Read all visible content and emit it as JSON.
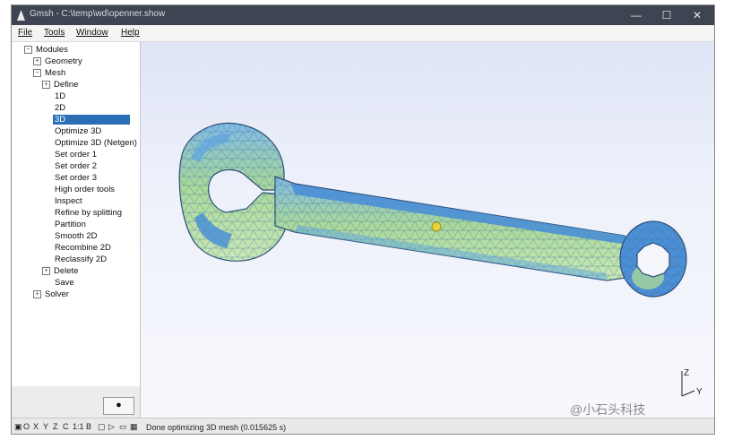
{
  "window": {
    "title": "Gmsh - C:\\temp\\wd\\openner.show",
    "minimize": "—",
    "maximize": "☐",
    "close": "✕"
  },
  "menu": [
    "File",
    "Tools",
    "Window",
    "Help"
  ],
  "tree": {
    "modules": "Modules",
    "geometry": "Geometry",
    "mesh": "Mesh",
    "define": "Define",
    "items": [
      "1D",
      "2D",
      "3D",
      "Optimize 3D",
      "Optimize 3D (Netgen)",
      "Set order 1",
      "Set order 2",
      "Set order 3",
      "High order tools",
      "Inspect",
      "Refine by splitting",
      "Partition",
      "Smooth 2D",
      "Recombine 2D",
      "Reclassify 2D"
    ],
    "delete": "Delete",
    "save": "Save",
    "solver": "Solver"
  },
  "button": "●",
  "statusbar": {
    "tools": [
      "O",
      "X",
      "Y",
      "Z",
      "C",
      "1:1",
      "B"
    ],
    "message": "Done optimizing 3D mesh (0.015625 s)"
  },
  "axes": {
    "z": "Z",
    "y": "Y"
  },
  "watermark": "@小石头科技",
  "colors": {
    "titlebar": "#3e4451",
    "selection": "#2a6fb6",
    "mesh_blue": "#4b8fd6",
    "mesh_green": "#9bd08a"
  }
}
